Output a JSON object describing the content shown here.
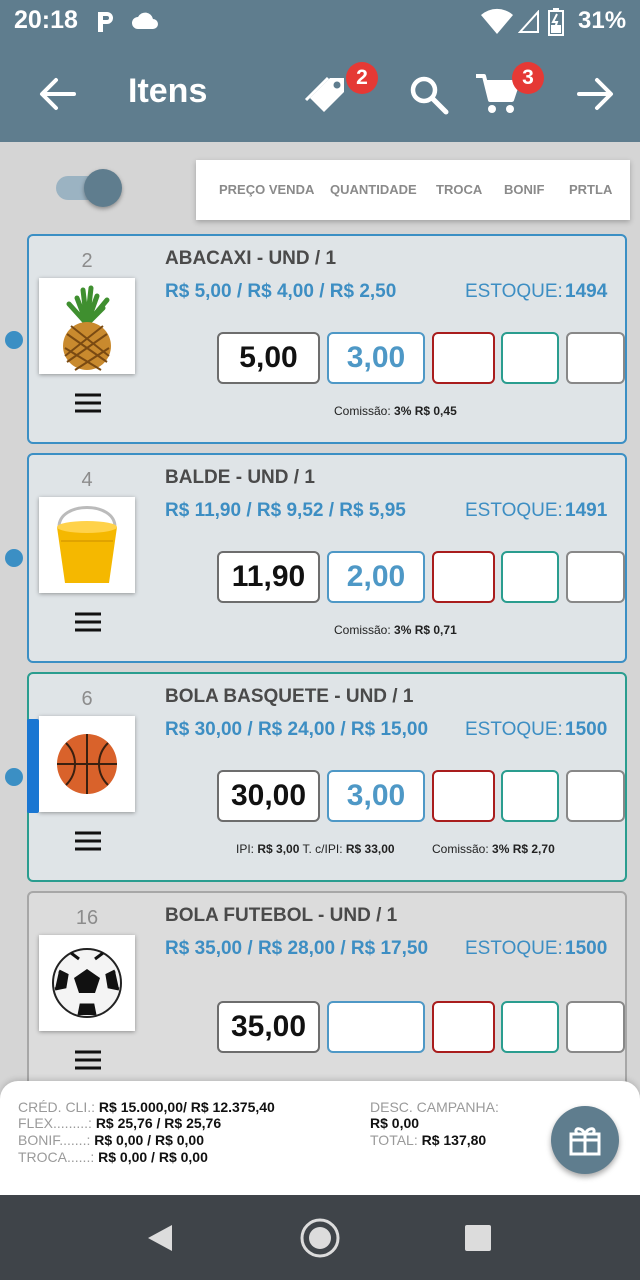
{
  "status_bar": {
    "time": "20:18",
    "battery": "31%"
  },
  "app_bar": {
    "title": "Itens",
    "tag_badge": "2",
    "cart_badge": "3"
  },
  "columns": [
    "PREÇO VENDA",
    "QUANTIDADE",
    "TROCA",
    "BONIF",
    "PRTLA"
  ],
  "items": [
    {
      "index": "2",
      "name": "ABACAXI - UND / 1",
      "prices": "R$ 5,00 / R$ 4,00 / R$ 2,50",
      "stock_label": "ESTOQUE:",
      "stock": "1494",
      "price_value": "5,00",
      "qty_value": "3,00",
      "ipi_label": "",
      "ipi": "",
      "ipi_total_label": "",
      "ipi_total": "",
      "commission_label": "Comissão:",
      "commission": "3% R$ 0,45",
      "image": "pineapple"
    },
    {
      "index": "4",
      "name": "BALDE - UND / 1",
      "prices": "R$ 11,90 / R$ 9,52 / R$ 5,95",
      "stock_label": "ESTOQUE:",
      "stock": "1491",
      "price_value": "11,90",
      "qty_value": "2,00",
      "ipi_label": "",
      "ipi": "",
      "ipi_total_label": "",
      "ipi_total": "",
      "commission_label": "Comissão:",
      "commission": "3% R$ 0,71",
      "image": "bucket"
    },
    {
      "index": "6",
      "name": "BOLA BASQUETE - UND / 1",
      "prices": "R$ 30,00 / R$ 24,00 / R$ 15,00",
      "stock_label": "ESTOQUE:",
      "stock": "1500",
      "price_value": "30,00",
      "qty_value": "3,00",
      "ipi_label": "IPI:",
      "ipi": "R$ 3,00",
      "ipi_total_label": "T. c/IPI:",
      "ipi_total": "R$ 33,00",
      "commission_label": "Comissão:",
      "commission": "3% R$ 2,70",
      "image": "basketball"
    },
    {
      "index": "16",
      "name": "BOLA FUTEBOL - UND / 1",
      "prices": "R$ 35,00 / R$ 28,00 / R$ 17,50",
      "stock_label": "ESTOQUE:",
      "stock": "1500",
      "price_value": "35,00",
      "qty_value": "",
      "image": "soccer-ball"
    }
  ],
  "summary": {
    "credit_label": "CRÉD. CLI.:",
    "credit": "R$ 15.000,00/ R$ 12.375,40",
    "flex_label": "FLEX.........:",
    "flex": "R$ 25,76 / R$ 25,76",
    "bonif_label": "BONIF.......:",
    "bonif": "R$ 0,00 / R$ 0,00",
    "troca_label": "TROCA......:",
    "troca": "R$ 0,00 / R$ 0,00",
    "campaign_label": "DESC. CAMPANHA:",
    "campaign": "R$ 0,00",
    "total_label": "TOTAL:",
    "total": "R$ 137,80"
  },
  "colors": {
    "primary": "#5f7d8e",
    "accent_blue": "#3d8ec3",
    "troca_red": "#a91d1d",
    "bonif_teal": "#2a9d8f",
    "badge_red": "#e53935"
  }
}
